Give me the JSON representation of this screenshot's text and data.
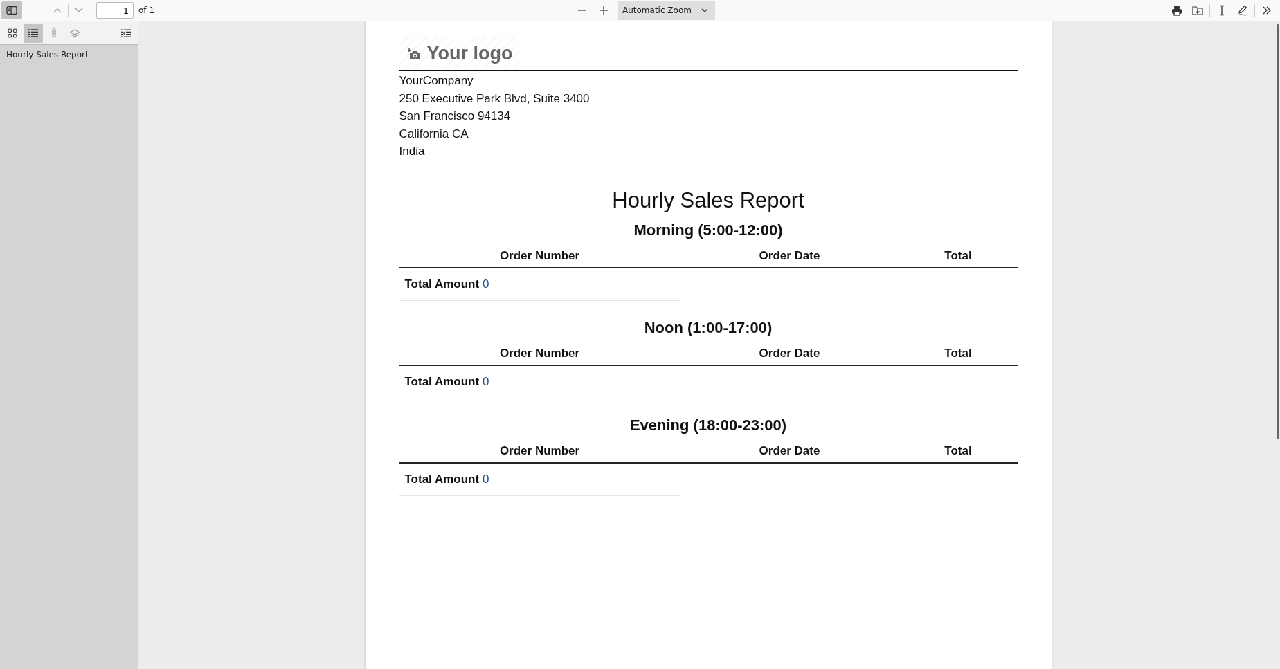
{
  "toolbar": {
    "sidebar_toggle": {
      "on": true
    },
    "page_number": "1",
    "page_count": "of 1",
    "zoom": "Automatic Zoom"
  },
  "sidebar": {
    "views": [
      {
        "kind": "thumbnails",
        "selected": false
      },
      {
        "kind": "outline",
        "selected": true
      },
      {
        "kind": "attachments",
        "selected": false
      },
      {
        "kind": "layers",
        "selected": false
      }
    ],
    "outline": [
      "Hourly Sales Report"
    ]
  },
  "document": {
    "logo": "Your logo",
    "address": [
      "YourCompany",
      "250 Executive Park Blvd, Suite 3400",
      "San Francisco 94134",
      "California CA",
      "India"
    ],
    "title": "Hourly Sales Report",
    "sections": [
      {
        "heading": "Morning (5:00-12:00)",
        "columns": [
          "Order Number",
          "Order Date",
          "Total"
        ],
        "total_label": "Total Amount",
        "total_value": "0"
      },
      {
        "heading": "Noon (1:00-17:00)",
        "columns": [
          "Order Number",
          "Order Date",
          "Total"
        ],
        "total_label": "Total Amount",
        "total_value": "0"
      },
      {
        "heading": "Evening (18:00-23:00)",
        "columns": [
          "Order Number",
          "Order Date",
          "Total"
        ],
        "total_label": "Total Amount",
        "total_value": "0"
      }
    ]
  }
}
